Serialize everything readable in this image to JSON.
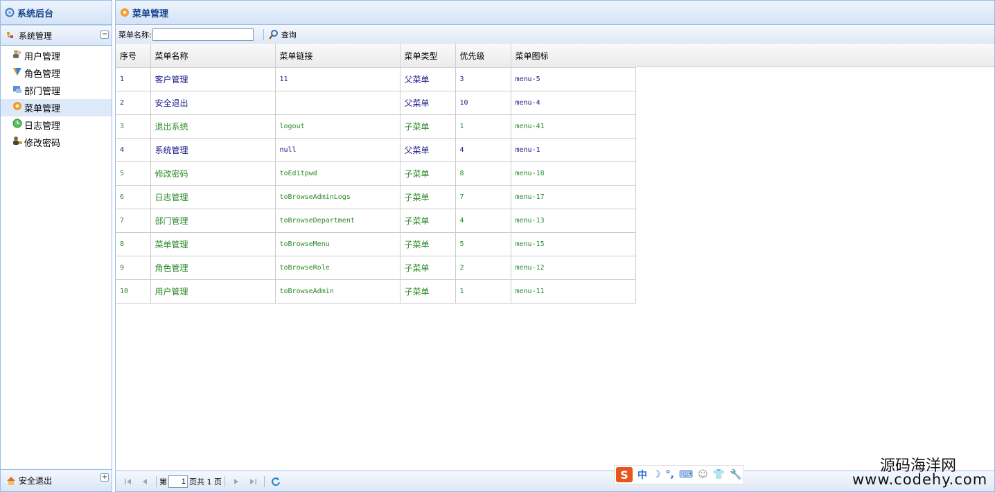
{
  "sidebar": {
    "title": "系统后台",
    "group_label": "系统管理",
    "items": [
      {
        "label": "用户管理"
      },
      {
        "label": "角色管理"
      },
      {
        "label": "部门管理"
      },
      {
        "label": "菜单管理"
      },
      {
        "label": "日志管理"
      },
      {
        "label": "修改密码"
      }
    ],
    "active_index": 3,
    "logout_label": "安全退出"
  },
  "main": {
    "title": "菜单管理",
    "search": {
      "label": "菜单名称:",
      "value": "",
      "button_label": "查询"
    },
    "columns": [
      "序号",
      "菜单名称",
      "菜单链接",
      "菜单类型",
      "优先级",
      "菜单图标"
    ],
    "rows": [
      {
        "no": "1",
        "name": "客户管理",
        "link": "11",
        "type": "父菜单",
        "priority": "3",
        "icon": "menu-5"
      },
      {
        "no": "2",
        "name": "安全退出",
        "link": "",
        "type": "父菜单",
        "priority": "10",
        "icon": "menu-4"
      },
      {
        "no": "3",
        "name": "退出系统",
        "link": "logout",
        "type": "子菜单",
        "priority": "1",
        "icon": "menu-41"
      },
      {
        "no": "4",
        "name": "系统管理",
        "link": "null",
        "type": "父菜单",
        "priority": "4",
        "icon": "menu-1"
      },
      {
        "no": "5",
        "name": "修改密码",
        "link": "toEditpwd",
        "type": "子菜单",
        "priority": "8",
        "icon": "menu-18"
      },
      {
        "no": "6",
        "name": "日志管理",
        "link": "toBrowseAdminLogs",
        "type": "子菜单",
        "priority": "7",
        "icon": "menu-17"
      },
      {
        "no": "7",
        "name": "部门管理",
        "link": "toBrowseDepartment",
        "type": "子菜单",
        "priority": "4",
        "icon": "menu-13"
      },
      {
        "no": "8",
        "name": "菜单管理",
        "link": "toBrowseMenu",
        "type": "子菜单",
        "priority": "5",
        "icon": "menu-15"
      },
      {
        "no": "9",
        "name": "角色管理",
        "link": "toBrowseRole",
        "type": "子菜单",
        "priority": "2",
        "icon": "menu-12"
      },
      {
        "no": "10",
        "name": "用户管理",
        "link": "toBrowseAdmin",
        "type": "子菜单",
        "priority": "1",
        "icon": "menu-11"
      }
    ]
  },
  "pager": {
    "before": "第",
    "page": "1",
    "after": "页共 1 页"
  },
  "ime": {
    "logo": "S",
    "mode": "中"
  },
  "watermark": {
    "line1": "源码海洋网",
    "line2": "www.codehy.com"
  },
  "colors": {
    "parent_row": "#1a1a8a",
    "child_row": "#2a8a2a",
    "border": "#99bbe8"
  }
}
